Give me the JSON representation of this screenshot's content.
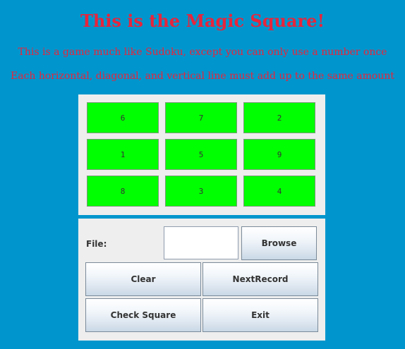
{
  "header": {
    "title": "This is the Magic Square!",
    "line1": "This is a game much like Sudoku, except you can only use a number once",
    "line2": "Each horizontal, diagonal, and vertical line must add up to the same amount"
  },
  "grid": {
    "cells": [
      "6",
      "7",
      "2",
      "1",
      "5",
      "9",
      "8",
      "3",
      "4"
    ],
    "cell_color": "#00ff00"
  },
  "controls": {
    "file_label": "File:",
    "file_value": "",
    "browse_label": "Browse",
    "clear_label": "Clear",
    "next_label": "NextRecord",
    "check_label": "Check Square",
    "exit_label": "Exit"
  },
  "colors": {
    "background": "#0096cd",
    "heading": "#e8243b"
  }
}
